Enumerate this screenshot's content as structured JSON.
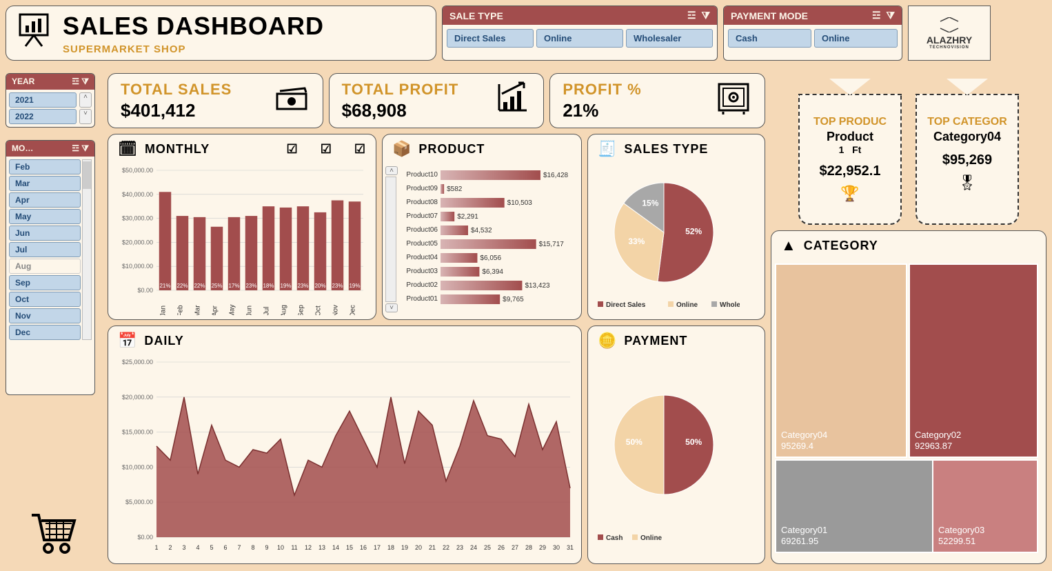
{
  "header": {
    "title": "SALES DASHBOARD",
    "subtitle": "SUPERMARKET SHOP",
    "logo": "ALAZHRY",
    "logo_sub": "TECHNOVISION"
  },
  "slicers": {
    "sale_type": {
      "label": "SALE TYPE",
      "items": [
        "Direct Sales",
        "Online",
        "Wholesaler"
      ]
    },
    "payment": {
      "label": "PAYMENT MODE",
      "items": [
        "Cash",
        "Online"
      ]
    },
    "year": {
      "label": "YEAR",
      "items": [
        "2021",
        "2022"
      ]
    },
    "month": {
      "label": "MO…",
      "items": [
        "Feb",
        "Mar",
        "Apr",
        "May",
        "Jun",
        "Jul",
        "Aug",
        "Sep",
        "Oct",
        "Nov",
        "Dec"
      ]
    }
  },
  "kpis": {
    "total_sales": {
      "label": "TOTAL SALES",
      "value": "$401,412"
    },
    "total_profit": {
      "label": "TOTAL PROFIT",
      "value": "$68,908"
    },
    "profit_pct": {
      "label": "PROFIT %",
      "value": "21%"
    }
  },
  "top_product": {
    "label": "TOP PRODUC",
    "name": "Product",
    "rank": "1",
    "unit": "Ft",
    "value": "$22,952.1"
  },
  "top_category": {
    "label": "TOP CATEGOR",
    "name": "Category04",
    "value": "$95,269"
  },
  "panels": {
    "monthly": "MONTHLY",
    "product": "PRODUCT",
    "sales_type": "SALES TYPE",
    "daily": "DAILY",
    "payment": "PAYMENT",
    "category": "CATEGORY"
  },
  "chart_data": [
    {
      "type": "bar",
      "id": "monthly",
      "title": "MONTHLY",
      "ylim": [
        0,
        50000
      ],
      "yticks": [
        0,
        10000,
        20000,
        30000,
        40000,
        50000
      ],
      "yticklabels": [
        "$0.00",
        "$10,000.00",
        "$20,000.00",
        "$30,000.00",
        "$40,000.00",
        "$50,000.00"
      ],
      "categories": [
        "Jan",
        "Feb",
        "Mar",
        "Apr",
        "May",
        "Jun",
        "Jul",
        "Aug",
        "Sep",
        "Oct",
        "Nov",
        "Dec"
      ],
      "values": [
        41000,
        31000,
        30500,
        26500,
        30500,
        31000,
        35000,
        34500,
        35000,
        32500,
        37500,
        37000
      ],
      "labels": [
        "21%",
        "22%",
        "22%",
        "25%",
        "17%",
        "23%",
        "18%",
        "19%",
        "23%",
        "20%",
        "23%",
        "19%"
      ]
    },
    {
      "type": "bar",
      "id": "product",
      "title": "PRODUCT",
      "orientation": "h",
      "categories": [
        "Product10",
        "Product09",
        "Product08",
        "Product07",
        "Product06",
        "Product05",
        "Product04",
        "Product03",
        "Product02",
        "Product01"
      ],
      "values": [
        16428,
        582,
        10503,
        2291,
        4532,
        15717,
        6056,
        6394,
        13423,
        9765
      ],
      "value_labels": [
        "$16,428",
        "$582",
        "$10,503",
        "$2,291",
        "$4,532",
        "$15,717",
        "$6,056",
        "$6,394",
        "$13,423",
        "$9,765"
      ]
    },
    {
      "type": "pie",
      "id": "sales_type",
      "title": "SALES TYPE",
      "series": [
        {
          "name": "Direct Sales",
          "value": 52
        },
        {
          "name": "Online",
          "value": 33
        },
        {
          "name": "Wholesaler",
          "value": 15
        }
      ],
      "legend": [
        "Direct Sales",
        "Online",
        "Wholesaler"
      ]
    },
    {
      "type": "area",
      "id": "daily",
      "title": "DAILY",
      "ylim": [
        0,
        25000
      ],
      "yticks": [
        0,
        5000,
        10000,
        15000,
        20000,
        25000
      ],
      "yticklabels": [
        "$0.00",
        "$5,000.00",
        "$10,000.00",
        "$15,000.00",
        "$20,000.00",
        "$25,000.00"
      ],
      "x": [
        1,
        2,
        3,
        4,
        5,
        6,
        7,
        8,
        9,
        10,
        11,
        12,
        13,
        14,
        15,
        16,
        17,
        18,
        19,
        20,
        21,
        22,
        23,
        24,
        25,
        26,
        27,
        28,
        29,
        30,
        31
      ],
      "values": [
        13000,
        11000,
        20000,
        9000,
        16000,
        11000,
        10000,
        12500,
        12000,
        14000,
        6000,
        11000,
        10000,
        14500,
        18000,
        14000,
        10000,
        20000,
        10500,
        18000,
        16000,
        8000,
        13000,
        19500,
        14500,
        14000,
        11500,
        19000,
        12500,
        16500,
        7000
      ]
    },
    {
      "type": "pie",
      "id": "payment",
      "title": "PAYMENT",
      "series": [
        {
          "name": "Cash",
          "value": 50
        },
        {
          "name": "Online",
          "value": 50
        }
      ],
      "legend": [
        "Cash",
        "Online"
      ]
    },
    {
      "type": "treemap",
      "id": "category",
      "title": "CATEGORY",
      "items": [
        {
          "name": "Category04",
          "value": 95269.4,
          "label": "95269.4"
        },
        {
          "name": "Category02",
          "value": 92963.87,
          "label": "92963.87"
        },
        {
          "name": "Category01",
          "value": 69261.95,
          "label": "69261.95"
        },
        {
          "name": "Category03",
          "value": 52299.51,
          "label": "52299.51"
        }
      ]
    }
  ]
}
